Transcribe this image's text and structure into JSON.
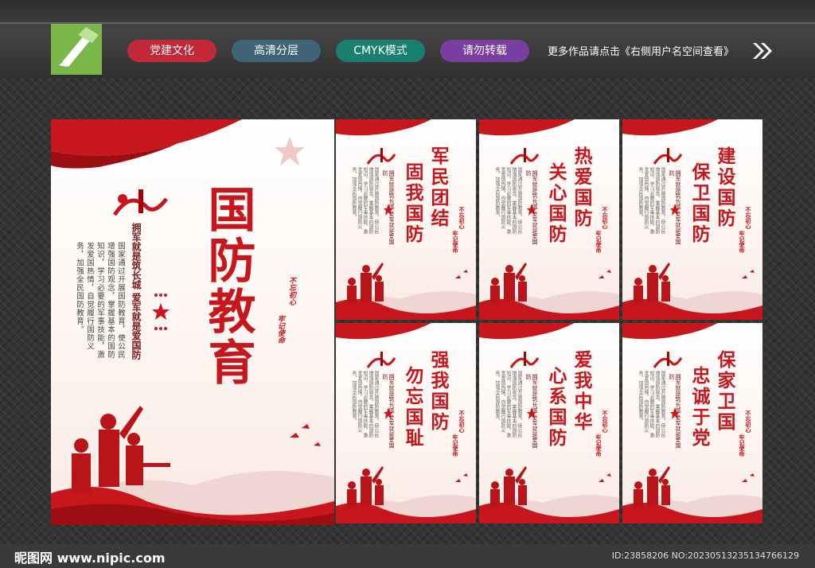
{
  "header": {
    "tags": [
      {
        "label": "党建文化",
        "color": "#c3283a"
      },
      {
        "label": "高清分层",
        "color": "#3f6478"
      },
      {
        "label": "CMYK模式",
        "color": "#1a7f6e"
      },
      {
        "label": "请勿转载",
        "color": "#7a3ea0"
      }
    ],
    "note": "更多作品请点击《右侧用户名空间查看》"
  },
  "main_poster": {
    "title": "国防教育",
    "slogan": "拥军就是筑长城  爱军就是爱国防",
    "body": "国家通过开展国防教育，使公民增强国防观念，掌握基本的国防知识，学习必要的军事技能，激发爱国热情，自觉履行国防义务，加强全民国防教育。",
    "stamp_left": "不忘初心",
    "stamp_right": "牢记使命"
  },
  "small_posters": [
    {
      "line1": "军民团结",
      "line2": "固我国防"
    },
    {
      "line1": "热爱国防",
      "line2": "关心国防"
    },
    {
      "line1": "建设国防",
      "line2": "保卫国防"
    },
    {
      "line1": "强我国防",
      "line2": "勿忘国耻"
    },
    {
      "line1": "爱我中华",
      "line2": "心系国防"
    },
    {
      "line1": "保家卫国",
      "line2": "忠诚于党"
    }
  ],
  "footer": {
    "site": "昵图网 www.nipic.com",
    "id": "ID:23858206 NO:20230513235134766129"
  },
  "colors": {
    "accent": "#c8161d",
    "logo_green": "#7ab648"
  }
}
